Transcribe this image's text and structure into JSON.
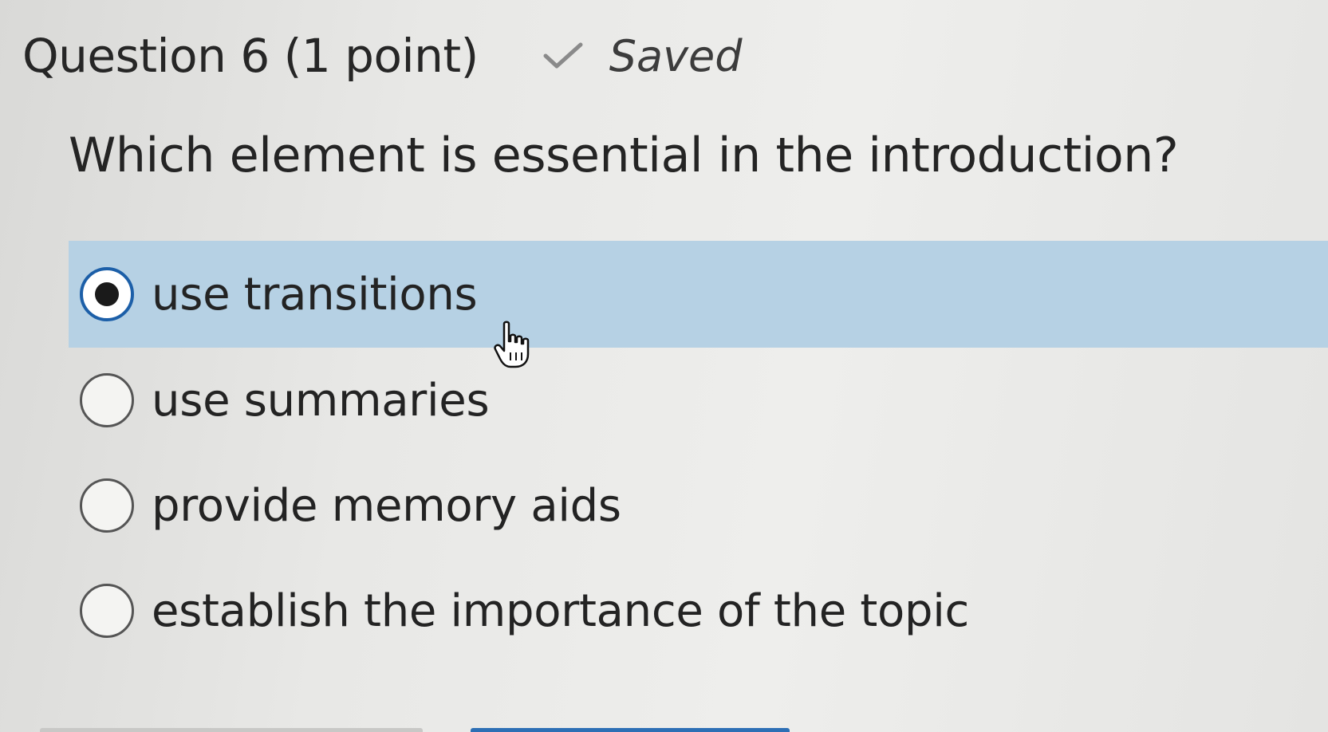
{
  "question": {
    "title": "Question 6 (1 point)",
    "saved_label": "Saved",
    "prompt": "Which element is essential in the introduction?"
  },
  "options": [
    {
      "label": "use transitions",
      "selected": true
    },
    {
      "label": "use summaries",
      "selected": false
    },
    {
      "label": "provide memory aids",
      "selected": false
    },
    {
      "label": "establish the importance of the topic",
      "selected": false
    }
  ],
  "icons": {
    "saved": "check-icon",
    "cursor": "hand-pointer-icon"
  },
  "colors": {
    "selected_row": "#b6d1e4",
    "selected_radio_border": "#1c5fa8",
    "saved_check": "#8a8a8a"
  }
}
